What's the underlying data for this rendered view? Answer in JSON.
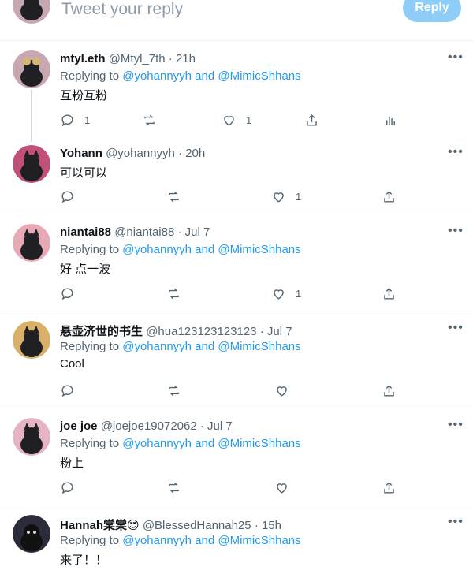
{
  "composer": {
    "placeholder": "Tweet your reply",
    "reply_label": "Reply"
  },
  "ui": {
    "more": "•••",
    "replying_prefix": "Replying to",
    "and": "and",
    "dot": "·"
  },
  "colors": {
    "accent": "#1d9bf0",
    "reply_button": "#8ecdf7",
    "muted": "#536471"
  },
  "tweets": [
    {
      "name": "mtyl.eth",
      "handle": "@Mtyl_7th",
      "time": "21h",
      "replying": true,
      "mentions": [
        "@yohannyyh",
        "@MimicShhans"
      ],
      "text": "互粉互粉",
      "reply_count": "1",
      "retweet_count": "",
      "like_count": "1",
      "has_analytics": true
    },
    {
      "name": "Yohann",
      "handle": "@yohannyyh",
      "time": "20h",
      "replying": false,
      "mentions": [],
      "text": "可以可以",
      "reply_count": "",
      "retweet_count": "",
      "like_count": "1",
      "has_analytics": false
    },
    {
      "name": "niantai88",
      "handle": "@niantai88",
      "time": "Jul 7",
      "replying": true,
      "mentions": [
        "@yohannyyh",
        "@MimicShhans"
      ],
      "text": "好 点一波",
      "reply_count": "",
      "retweet_count": "",
      "like_count": "1",
      "has_analytics": false
    },
    {
      "name": "悬壶济世的书生",
      "handle": "@hua123123123123",
      "time": "Jul 7",
      "replying": true,
      "mentions": [
        "@yohannyyh",
        "@MimicShhans"
      ],
      "text": "Cool",
      "reply_count": "",
      "retweet_count": "",
      "like_count": "",
      "has_analytics": false
    },
    {
      "name": "joe joe",
      "handle": "@joejoe19072062",
      "time": "Jul 7",
      "replying": true,
      "mentions": [
        "@yohannyyh",
        "@MimicShhans"
      ],
      "text": "粉上",
      "reply_count": "",
      "retweet_count": "",
      "like_count": "",
      "has_analytics": false
    },
    {
      "name": "Hannah棠棠😍",
      "handle": "@BlessedHannah25",
      "time": "15h",
      "replying": true,
      "mentions": [
        "@yohannyyh",
        "@MimicShhans"
      ],
      "text": "来了！！",
      "reply_count": "",
      "retweet_count": "",
      "like_count": "",
      "has_analytics": false
    }
  ]
}
